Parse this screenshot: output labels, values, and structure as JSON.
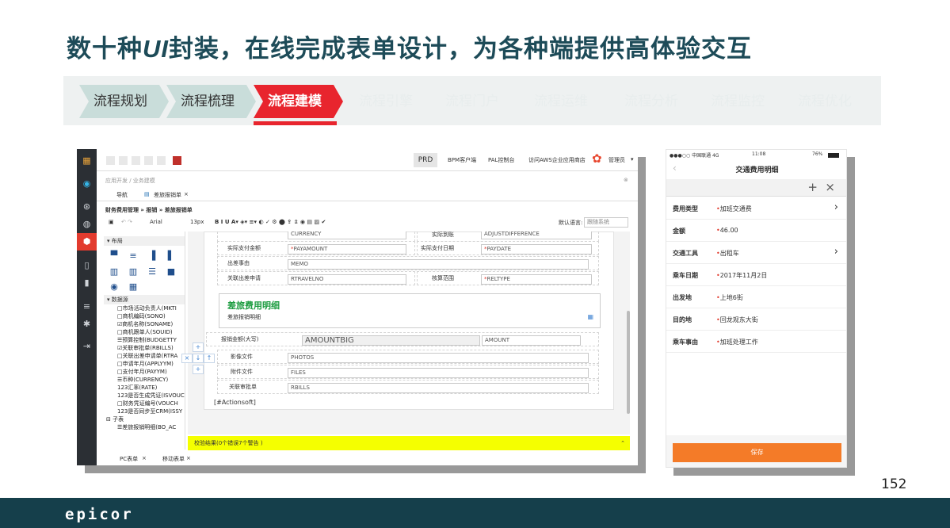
{
  "slide": {
    "title_pre": "数十种",
    "title_ui": "UI",
    "title_post": "封装，在线完成表单设计，为各种端提供高体验交互",
    "page_number": "152",
    "footer_logo": "epicor"
  },
  "steps": [
    "流程规划",
    "流程梳理",
    "流程建模",
    "流程引擎",
    "流程门户",
    "流程运维",
    "流程分析",
    "流程监控",
    "流程优化"
  ],
  "pc": {
    "top_links": {
      "prd": "PRD",
      "bpm": "BPM客户端",
      "pal": "PAL控制台",
      "aws": "访问AWS企业应用商店",
      "admin": "管理员",
      "menu": "▾"
    },
    "breadcrumb": "应用开发 / 业务建模",
    "tabs": {
      "nav": "导航",
      "form": "差旅报销单",
      "form_close": "×"
    },
    "path": "财务费用管理 » 报销 » 差旅报销单",
    "toolbar": {
      "font": "Arial",
      "size": "13px",
      "lang_label": "默认语言:",
      "lang_value": "跟随系统"
    },
    "left_panel": {
      "layout_head": "▾ 布局",
      "datasource_head": "▾ 数据源",
      "items": [
        "□市场活动负责人(MKTI",
        "□商机编码(SONO)",
        "☑商机名称(SONAME)",
        "□商机跟单人(SOUID)",
        "☰预算控制(BUDGETTY",
        "☑关联审批单(RBILLS)",
        "□关联出差申请单(RTRA",
        "□申请年月(APPLYYM)",
        "□支付年月(PAYYM)",
        "☰币种(CURRENCY)",
        "123汇率(RATE)",
        "123是否生成凭证(ISVOUC",
        "□财务凭证编号(VOUCH",
        "123是否同步至CRM(ISSY",
        "⊟ 子表",
        "☰差旅报销明细(BO_AC"
      ]
    },
    "form": {
      "row0_left": "CURRENCY",
      "row0_right_label": "实际到账",
      "row0_right": "ADJUSTDIFFERENCE",
      "pay_label": "实际支付金额",
      "pay_field": "PAYAMOUNT",
      "pay_date_label": "实际支付日期",
      "pay_date_field": "PAYDATE",
      "memo_label": "出差事由",
      "memo_field": "MEMO",
      "rtravel_label": "关联出差申请",
      "rtravel_field": "RTRAVELNO",
      "rel_label": "核算范围",
      "rel_field": "RELTYPE",
      "section_title": "差旅费用明细",
      "section_sub": "差旅报销明细",
      "amtbig_label": "报销金额(大写)",
      "amtbig_field": "AMOUNTBIG",
      "amount_field": "AMOUNT",
      "photos_label": "影像文件",
      "photos_field": "PHOTOS",
      "files_label": "附件文件",
      "files_field": "FILES",
      "rbills_label": "关联审批单",
      "rbills_field": "RBILLS",
      "actionsoft": "[#Actionsoft]"
    },
    "verify": "校验结果(0个错误7个警告 )",
    "bottom_tabs": {
      "pc": "PC表单",
      "mobile": "移动表单",
      "close": "×"
    }
  },
  "mobile": {
    "status_left": "●●●○○ 中国联通 4G",
    "status_time": "11:08",
    "status_right": "76%",
    "title": "交通费用明细",
    "back": "‹",
    "actions": "+  ×",
    "rows": [
      {
        "label": "费用类型",
        "value": "加班交通费",
        "chev": "›"
      },
      {
        "label": "金额",
        "value": "46.00",
        "chev": ""
      },
      {
        "label": "交通工具",
        "value": "出租车",
        "chev": "›"
      },
      {
        "label": "乘车日期",
        "value": "2017年11月2日",
        "chev": ""
      },
      {
        "label": "出发地",
        "value": "上地6街",
        "chev": ""
      },
      {
        "label": "目的地",
        "value": "回龙观东大街",
        "chev": ""
      },
      {
        "label": "乘车事由",
        "value": "加班处理工作",
        "chev": ""
      }
    ],
    "save": "保存"
  }
}
